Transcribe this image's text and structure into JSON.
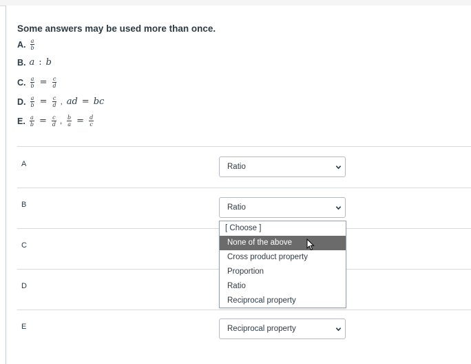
{
  "instruction": "Some answers may be used more than once.",
  "options": [
    {
      "letter": "A."
    },
    {
      "letter": "B.",
      "m1": "a",
      "op": ":",
      "m2": "b"
    },
    {
      "letter": "C.",
      "f1n": "a",
      "f1d": "b",
      "eq": "=",
      "f2n": "c",
      "f2d": "d"
    },
    {
      "letter": "D.",
      "f1n": "a",
      "f1d": "b",
      "eq": "=",
      "f2n": "c",
      "f2d": "d",
      "comma": ",",
      "m1": "ad",
      "eq2": "=",
      "m2": "bc"
    },
    {
      "letter": "E.",
      "f1n": "a",
      "f1d": "b",
      "eq": "=",
      "f2n": "c",
      "f2d": "d",
      "comma": ",",
      "f3n": "b",
      "f3d": "a",
      "eq2": "=",
      "f4n": "d",
      "f4d": "c"
    }
  ],
  "optionA_frac": {
    "num": "a",
    "den": "b"
  },
  "rows": [
    {
      "label": "A",
      "selected": "Ratio"
    },
    {
      "label": "B",
      "selected": "Ratio"
    },
    {
      "label": "C"
    },
    {
      "label": "D"
    },
    {
      "label": "E",
      "selected": "Reciprocal property"
    }
  ],
  "dropdown": {
    "items": [
      "[ Choose ]",
      "None of the above",
      "Cross product property",
      "Proportion",
      "Ratio",
      "Reciprocal property"
    ],
    "highlighted": "None of the above"
  },
  "colors": {
    "highlight": "#6b6b6b",
    "text": "#2d3b45",
    "border": "#d7dadd"
  }
}
